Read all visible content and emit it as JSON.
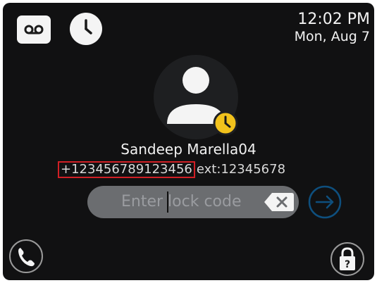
{
  "status_bar": {
    "time": "12:02 PM",
    "date": "Mon, Aug 7",
    "left_icons": [
      "voicemail-icon",
      "clock-icon"
    ]
  },
  "caller": {
    "name": "Sandeep Marella04",
    "number": "+123456789123456",
    "extension": "ext:12345678",
    "avatar_icon": "person-icon",
    "status_icon": "clock-badge-icon"
  },
  "lock_screen": {
    "input_placeholder": "Enter lock code",
    "backspace_icon": "backspace-icon",
    "submit_icon": "arrow-right-icon"
  },
  "bottom_bar": {
    "call_icon": "phone-icon",
    "lock_icon": "padlock-question-icon"
  },
  "colors": {
    "background": "#111112",
    "highlight_box": "#d11f25",
    "status_badge": "#f2c21c",
    "submit_accent": "#0e4f7e"
  }
}
